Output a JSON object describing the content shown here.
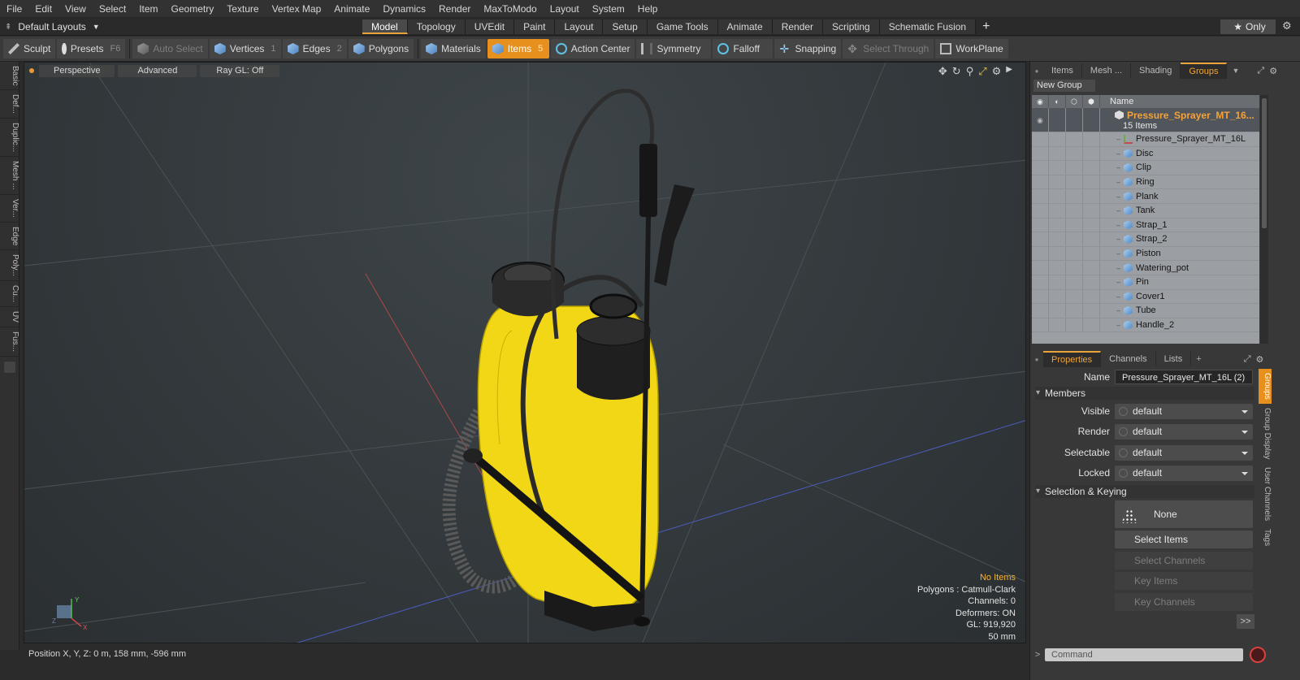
{
  "menu": [
    "File",
    "Edit",
    "View",
    "Select",
    "Item",
    "Geometry",
    "Texture",
    "Vertex Map",
    "Animate",
    "Dynamics",
    "Render",
    "MaxToModo",
    "Layout",
    "System",
    "Help"
  ],
  "layout_bar": {
    "layout_name": "Default Layouts",
    "tabs": [
      "Model",
      "Topology",
      "UVEdit",
      "Paint",
      "Layout",
      "Setup",
      "Game Tools",
      "Animate",
      "Render",
      "Scripting",
      "Schematic Fusion"
    ],
    "active_tab": "Model",
    "only_label": "Only"
  },
  "toolbar": {
    "sculpt": "Sculpt",
    "presets": "Presets",
    "presets_key": "F6",
    "auto_select": "Auto Select",
    "vertices": "Vertices",
    "vertices_key": "1",
    "edges": "Edges",
    "edges_key": "2",
    "polygons": "Polygons",
    "materials": "Materials",
    "items": "Items",
    "items_key": "5",
    "action_center": "Action Center",
    "symmetry": "Symmetry",
    "falloff": "Falloff",
    "snapping": "Snapping",
    "select_through": "Select Through",
    "workplane": "WorkPlane"
  },
  "left_tabs": [
    "Basic",
    "Def...",
    "Duplic...",
    "Mesh ...",
    "Ver...",
    "Edge",
    "Poly...",
    "Cu...",
    "UV",
    "Fus..."
  ],
  "viewport": {
    "view_mode": "Perspective",
    "advanced": "Advanced",
    "ray_gl": "Ray GL: Off",
    "info": {
      "no_items": "No Items",
      "polygons": "Polygons : Catmull-Clark",
      "channels": "Channels: 0",
      "deformers": "Deformers: ON",
      "gl": "GL: 919,920",
      "focal": "50 mm"
    },
    "axis_labels": {
      "x": "X",
      "y": "Y",
      "z": "Z"
    },
    "colors": {
      "tank": "#f1d715",
      "accent": "#e8901e"
    }
  },
  "status": {
    "position": "Position X, Y, Z:  0 m, 158 mm, -596 mm"
  },
  "right_panel": {
    "tabs": [
      "Items",
      "Mesh ...",
      "Shading",
      "Groups"
    ],
    "active_tab": "Groups",
    "new_group": "New Group",
    "tree_header": "Name",
    "group": {
      "name": "Pressure_Sprayer_MT_16...",
      "count": "15 Items"
    },
    "items": [
      {
        "name": "Pressure_Sprayer_MT_16L",
        "icon": "locator-icon"
      },
      {
        "name": "Disc",
        "icon": "mesh-icon"
      },
      {
        "name": "Clip",
        "icon": "mesh-icon"
      },
      {
        "name": "Ring",
        "icon": "mesh-icon"
      },
      {
        "name": "Plank",
        "icon": "mesh-icon"
      },
      {
        "name": "Tank",
        "icon": "mesh-icon"
      },
      {
        "name": "Strap_1",
        "icon": "mesh-icon"
      },
      {
        "name": "Strap_2",
        "icon": "mesh-icon"
      },
      {
        "name": "Piston",
        "icon": "mesh-icon"
      },
      {
        "name": "Watering_pot",
        "icon": "mesh-icon"
      },
      {
        "name": "Pin",
        "icon": "mesh-icon"
      },
      {
        "name": "Cover1",
        "icon": "mesh-icon"
      },
      {
        "name": "Tube",
        "icon": "mesh-icon"
      },
      {
        "name": "Handle_2",
        "icon": "mesh-icon"
      }
    ]
  },
  "properties": {
    "tabs": [
      "Properties",
      "Channels",
      "Lists"
    ],
    "active_tab": "Properties",
    "name_label": "Name",
    "name_value": "Pressure_Sprayer_MT_16L (2)",
    "members_section": "Members",
    "visible_label": "Visible",
    "visible_value": "default",
    "render_label": "Render",
    "render_value": "default",
    "selectable_label": "Selectable",
    "selectable_value": "default",
    "locked_label": "Locked",
    "locked_value": "default",
    "selection_section": "Selection & Keying",
    "none_label": "None",
    "select_items": "Select Items",
    "select_channels": "Select Channels",
    "key_items": "Key Items",
    "key_channels": "Key Channels",
    "more": ">>",
    "side_tabs": [
      "Groups",
      "Group Display",
      "User Channels",
      "Tags"
    ]
  },
  "command": {
    "placeholder": "Command"
  }
}
